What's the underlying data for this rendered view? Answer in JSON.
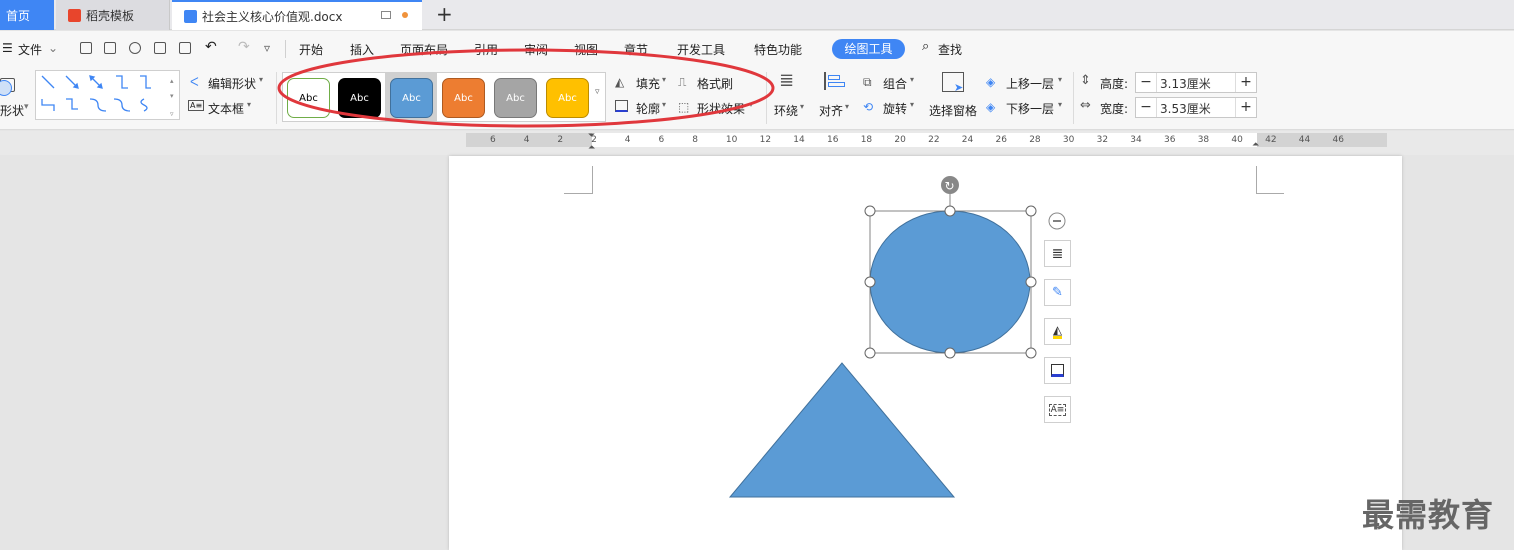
{
  "tabs": [
    {
      "label": "首页"
    },
    {
      "label": "稻壳模板"
    },
    {
      "label": "社会主义核心价值观.docx"
    }
  ],
  "menu": {
    "file_label": "文件",
    "items": [
      "开始",
      "插入",
      "页面布局",
      "引用",
      "审阅",
      "视图",
      "章节",
      "开发工具",
      "特色功能"
    ],
    "active_tool": "绘图工具",
    "search": "查找"
  },
  "ribbon": {
    "shape_label": "形状",
    "edit_shape": "编辑形状",
    "text_box": "文本框",
    "style_sample": "Abc",
    "fill": "填充",
    "format_brush": "格式刷",
    "outline": "轮廓",
    "shape_effects": "形状效果",
    "wrap": "环绕",
    "align": "对齐",
    "group": "组合",
    "rotate": "旋转",
    "selection_pane": "选择窗格",
    "bring_forward": "上移一层",
    "send_backward": "下移一层",
    "height_label": "高度:",
    "height_value": "3.13厘米",
    "width_label": "宽度:",
    "width_value": "3.53厘米"
  },
  "colors": {
    "accent": "#3f86f4",
    "shape_fill": "#5b9bd5",
    "shape_stroke": "#41719c",
    "annotation": "#e0373c",
    "style_swatches": [
      "#ffffff",
      "#000000",
      "#5b9bd5",
      "#ed7d31",
      "#a5a5a5",
      "#ffc000"
    ]
  },
  "ruler": {
    "numbers": [
      "6",
      "4",
      "2",
      "2",
      "4",
      "6",
      "8",
      "10",
      "12",
      "14",
      "16",
      "18",
      "20",
      "22",
      "24",
      "26",
      "28",
      "30",
      "32",
      "34",
      "36",
      "38",
      "40",
      "42",
      "44",
      "46"
    ]
  },
  "watermark": "最需教育"
}
